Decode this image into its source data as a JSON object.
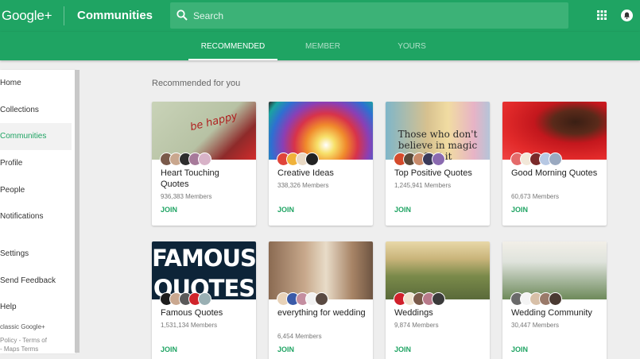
{
  "header": {
    "brand": "Google+",
    "section_title": "Communities",
    "search_placeholder": "Search",
    "accent_color": "#1fa463"
  },
  "tabs": [
    {
      "label": "RECOMMENDED",
      "active": true
    },
    {
      "label": "MEMBER",
      "active": false
    },
    {
      "label": "YOURS",
      "active": false
    }
  ],
  "sidebar": {
    "items": [
      {
        "label": "Home",
        "active": false
      },
      {
        "label": "Collections",
        "active": false
      },
      {
        "label": "Communities",
        "active": true
      },
      {
        "label": "Profile",
        "active": false
      },
      {
        "label": "People",
        "active": false
      },
      {
        "label": "Notifications",
        "active": false
      },
      {
        "label": "Settings",
        "active": false
      },
      {
        "label": "Send Feedback",
        "active": false
      },
      {
        "label": "Help",
        "active": false
      }
    ],
    "footer_classic": "classic Google+",
    "footer_policy": "Policy - Terms of",
    "footer_maps": "- Maps Terms"
  },
  "main": {
    "title": "Recommended for you",
    "join_label": "JOIN",
    "communities": [
      {
        "name": "Heart Touching Quotes",
        "members": "936,383 Members",
        "cover_text": "be happy"
      },
      {
        "name": "Creative Ideas",
        "members": "338,326 Members",
        "cover_text": ""
      },
      {
        "name": "Top Positive Quotes",
        "members": "1,245,941 Members",
        "cover_text": "Those who don't believe in magic find it"
      },
      {
        "name": "Good Morning Quotes",
        "members": "60,673 Members",
        "cover_text": ""
      },
      {
        "name": "Famous Quotes",
        "members": "1,531,134 Members",
        "cover_text": "FAMOUS QUOTES"
      },
      {
        "name": "everything for wedding",
        "members": "6,454 Members",
        "cover_text": ""
      },
      {
        "name": "Weddings",
        "members": "9,874 Members",
        "cover_text": ""
      },
      {
        "name": "Wedding Community",
        "members": "30,447 Members",
        "cover_text": ""
      }
    ]
  }
}
